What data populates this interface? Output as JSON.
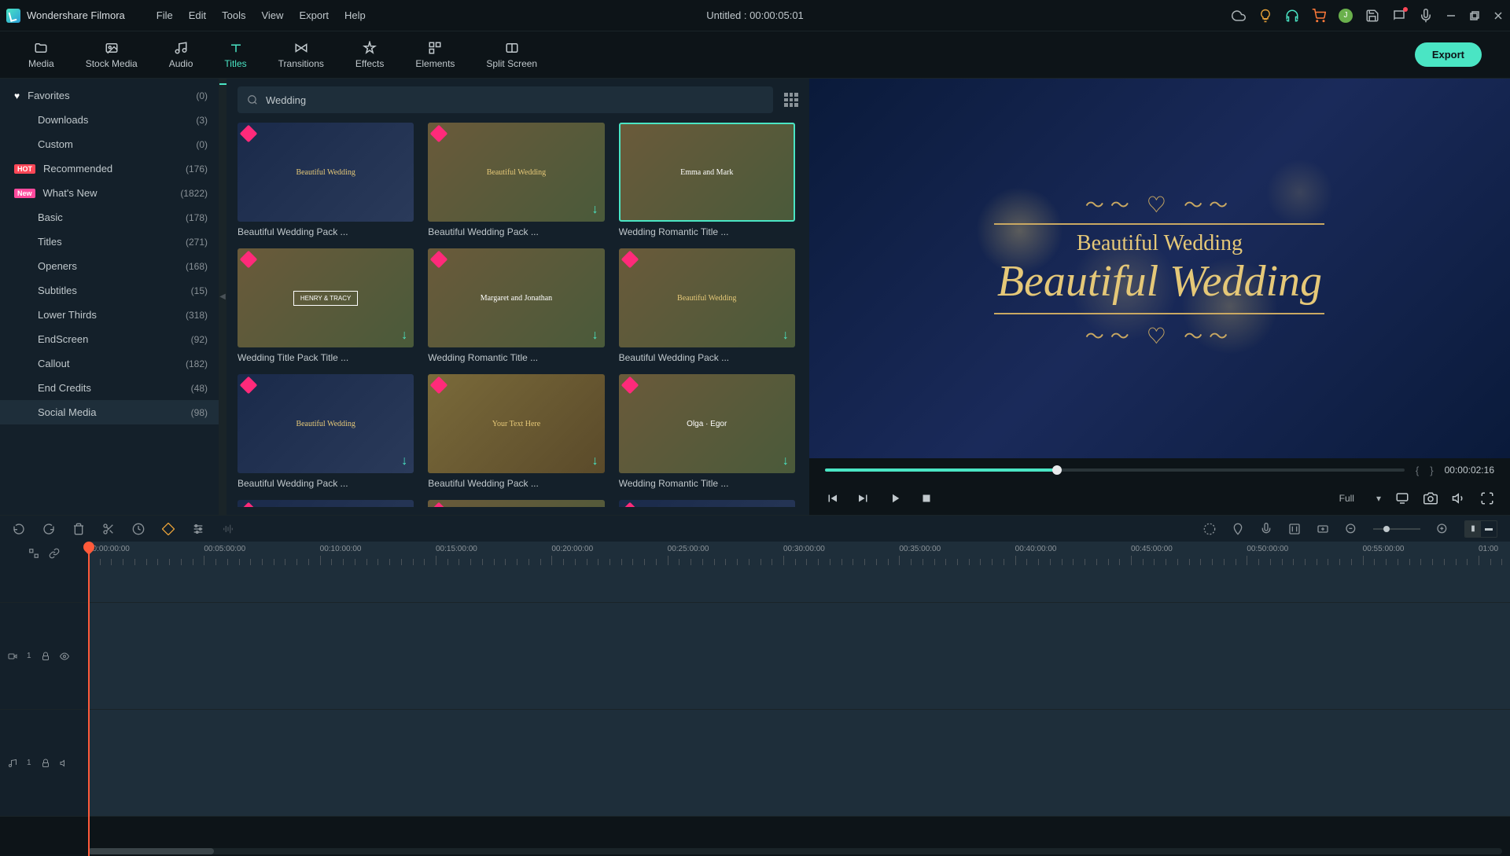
{
  "app": {
    "name": "Wondershare Filmora",
    "title": "Untitled : 00:00:05:01",
    "avatar_letter": "J"
  },
  "menu": {
    "file": "File",
    "edit": "Edit",
    "tools": "Tools",
    "view": "View",
    "export": "Export",
    "help": "Help"
  },
  "tool_tabs": {
    "media": "Media",
    "stock": "Stock Media",
    "audio": "Audio",
    "titles": "Titles",
    "transitions": "Transitions",
    "effects": "Effects",
    "elements": "Elements",
    "split": "Split Screen"
  },
  "export_label": "Export",
  "sidebar": {
    "items": [
      {
        "label": "Favorites",
        "count": "(0)"
      },
      {
        "label": "Downloads",
        "count": "(3)"
      },
      {
        "label": "Custom",
        "count": "(0)"
      },
      {
        "label": "Recommended",
        "count": "(176)",
        "badge": "HOT"
      },
      {
        "label": "What's New",
        "count": "(1822)",
        "badge": "New"
      },
      {
        "label": "Basic",
        "count": "(178)"
      },
      {
        "label": "Titles",
        "count": "(271)"
      },
      {
        "label": "Openers",
        "count": "(168)"
      },
      {
        "label": "Subtitles",
        "count": "(15)"
      },
      {
        "label": "Lower Thirds",
        "count": "(318)"
      },
      {
        "label": "EndScreen",
        "count": "(92)"
      },
      {
        "label": "Callout",
        "count": "(182)"
      },
      {
        "label": "End Credits",
        "count": "(48)"
      },
      {
        "label": "Social Media",
        "count": "(98)"
      }
    ]
  },
  "search": {
    "value": "Wedding"
  },
  "thumbs": [
    {
      "label": "Beautiful Wedding Pack ..."
    },
    {
      "label": "Beautiful Wedding Pack ..."
    },
    {
      "label": "Wedding Romantic Title ..."
    },
    {
      "label": "Wedding Title Pack Title ..."
    },
    {
      "label": "Wedding Romantic Title ..."
    },
    {
      "label": "Beautiful Wedding Pack ..."
    },
    {
      "label": "Beautiful Wedding Pack ..."
    },
    {
      "label": "Beautiful Wedding Pack ..."
    },
    {
      "label": "Wedding Romantic Title ..."
    }
  ],
  "thumb_text": {
    "t0": "Beautiful Wedding",
    "t1": "Beautiful Wedding",
    "t2": "Emma and Mark",
    "t3": "HENRY & TRACY",
    "t4": "Margaret and Jonathan",
    "t5": "Beautiful Wedding",
    "t6": "Beautiful Wedding",
    "t7": "Your Text Here",
    "t8": "Olga · Egor"
  },
  "preview": {
    "line1": "Beautiful Wedding",
    "line2": "Beautiful Wedding",
    "quality": "Full",
    "current_time": "00:00:02:16"
  },
  "ruler": {
    "marks": [
      "00:00:00:00",
      "00:05:00:00",
      "00:10:00:00",
      "00:15:00:00",
      "00:20:00:00",
      "00:25:00:00",
      "00:30:00:00",
      "00:35:00:00",
      "00:40:00:00",
      "00:45:00:00",
      "00:50:00:00",
      "00:55:00:00",
      "01:00"
    ]
  },
  "tracks": {
    "video": "1",
    "audio": "1"
  }
}
